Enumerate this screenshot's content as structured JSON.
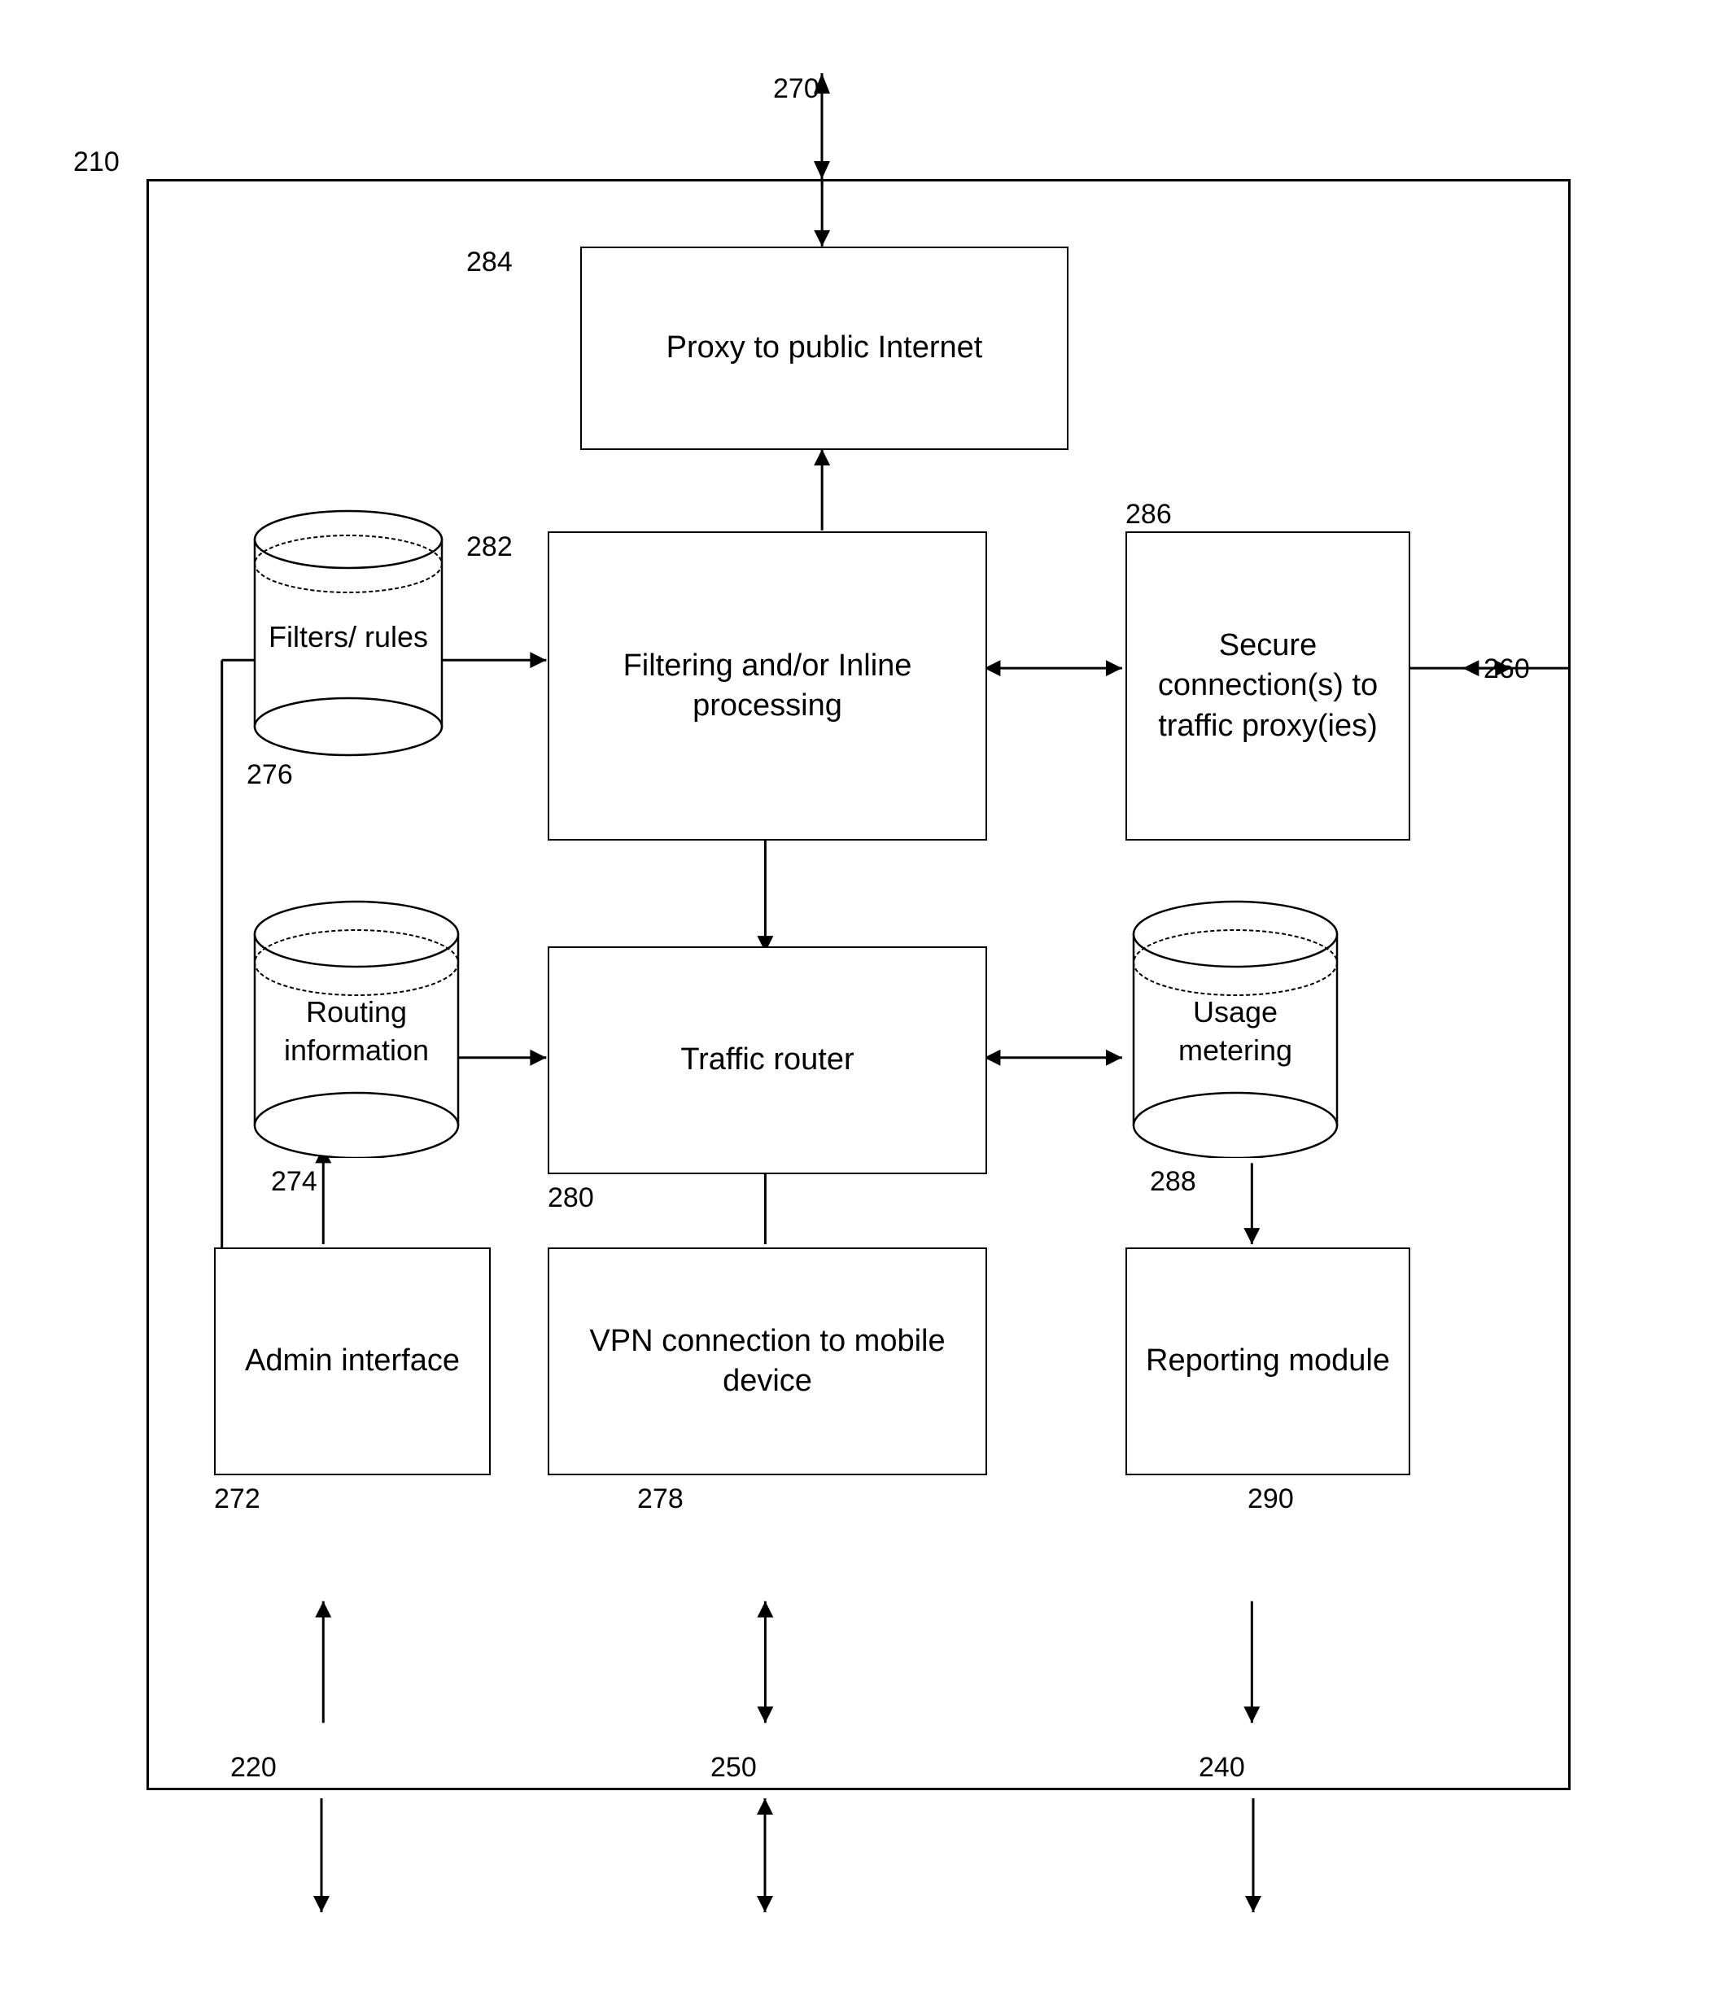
{
  "diagram": {
    "title": "210",
    "labels": {
      "n210": "210",
      "n220": "220",
      "n240": "240",
      "n250": "250",
      "n260": "260",
      "n270": "270",
      "n272": "272",
      "n274": "274",
      "n276": "276",
      "n278": "278",
      "n280": "280",
      "n282": "282",
      "n284": "284",
      "n286": "286",
      "n288": "288",
      "n290": "290"
    },
    "blocks": {
      "proxy": "Proxy to public Internet",
      "filtering": "Filtering and/or Inline processing",
      "secure": "Secure connection(s) to traffic proxy(ies)",
      "traffic_router": "Traffic router",
      "admin": "Admin interface",
      "vpn": "VPN connection to mobile device",
      "reporting": "Reporting module"
    },
    "cylinders": {
      "filters": "Filters/ rules",
      "routing": "Routing information",
      "usage": "Usage metering"
    }
  }
}
